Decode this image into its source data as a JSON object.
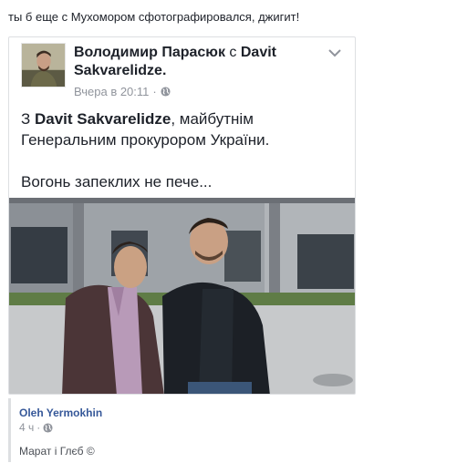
{
  "post": {
    "text": "ты б еще с Мухомором сфотографировался, джигит!"
  },
  "shared_post": {
    "author": "Володимир Парасюк",
    "with_word": "с",
    "tagged": "Davit Sakvarelidze.",
    "timestamp": "Вчера в 20:11",
    "separator": "·",
    "privacy_icon": "globe-icon",
    "options_icon": "chevron-down-icon",
    "body_line1_prefix": "З ",
    "body_line1_name": "Davit Sakvarelidze",
    "body_line1_suffix": ", майбутнім",
    "body_line2": "Генеральним прокурором України.",
    "body_line3": "Вогонь запеклих не пече..."
  },
  "comment": {
    "author": "Oleh Yermokhin",
    "time": "4 ч",
    "separator": "·",
    "privacy_icon": "globe-icon",
    "text": "Марат і Глєб ©"
  },
  "colors": {
    "link": "#365899",
    "meta": "#90949c",
    "text": "#1d2129",
    "border": "#dddfe2"
  }
}
